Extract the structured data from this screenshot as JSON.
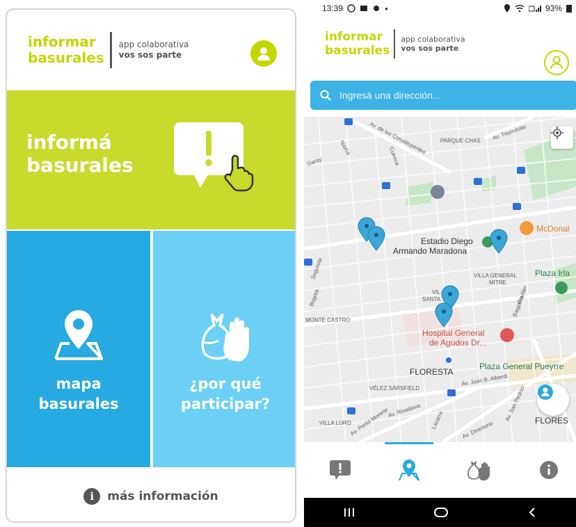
{
  "left": {
    "logo": {
      "line1": "informar",
      "line2": "basurales",
      "tagline1": "app colaborativa",
      "tagline2": "vos sos parte"
    },
    "report_tile": {
      "line1": "informá",
      "line2": "basurales"
    },
    "map_tile": {
      "line1": "mapa",
      "line2": "basurales"
    },
    "why_tile": {
      "line1": "¿por qué",
      "line2": "participar?"
    },
    "more_info": {
      "icon": "i",
      "label": "más información"
    }
  },
  "right": {
    "status": {
      "time": "13:39",
      "battery": "93%"
    },
    "logo": {
      "line1": "informar",
      "line2": "basurales",
      "tagline1": "app colaborativa",
      "tagline2": "vos sos parte"
    },
    "search": {
      "placeholder": "Ingresá una dirección..."
    },
    "map_labels": {
      "parque_chas": "PARQUE CHAS",
      "estadio": "Estadio Diego",
      "estadio2": "Armando Maradona",
      "mcdonalds": "McDonal",
      "villa_gm": "VILLA GENERAL",
      "villa_gm2": "MITRE",
      "plaza_irla": "Plaza Irla",
      "vil": "VIL",
      "santa": "SANTA",
      "monte_castro": "MONTE CASTRO",
      "hospital": "Hospital General",
      "hospital2": "de Agudos Dr...",
      "floresta": "FLORESTA",
      "plaza_pueyrr": "Plaza General Pueyrre",
      "velez": "VÉLEZ SÁRSFIELD",
      "villa_luro": "VILLA LURO",
      "flores": "FLORES",
      "av_triunvirato": "Av. Triunvirato",
      "av_constituyentes": "Av. de los Constituyentes",
      "nazca": "Nazca",
      "gavilan": "Gavilán",
      "av_rivadavia": "Av. Rivadavia",
      "av_moreno": "Av. Perito Moreno",
      "av_directorio": "Av. Directorio",
      "av_san_pedrito": "Av. San Pedrito",
      "lacarra": "Lacarra",
      "segurola": "Segurola",
      "bogota": "Bogotá",
      "cuenca": "Cuenca",
      "garay": "Garay",
      "baigorria": "Baigorria",
      "av_juan_b_alberdi": "Av. Juan B. Alberdi"
    }
  },
  "colors": {
    "lime": "#c8da2b",
    "blue": "#27a9e1",
    "light_blue": "#6ccff6",
    "map_pin": "#3aa7d8"
  }
}
